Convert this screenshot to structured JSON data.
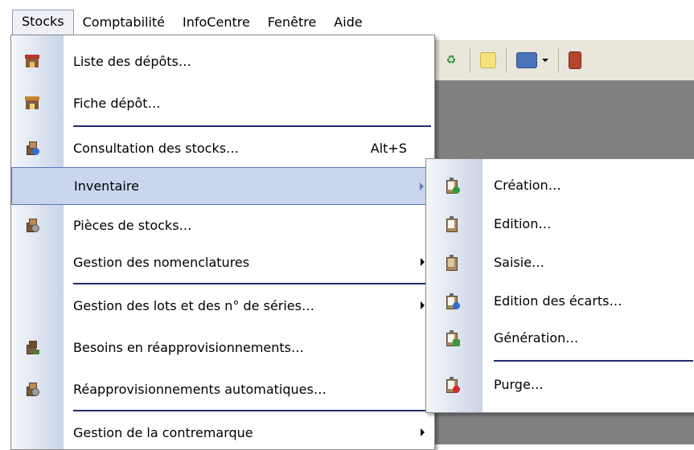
{
  "menubar": {
    "items": [
      {
        "label": "Stocks"
      },
      {
        "label": "Comptabilité"
      },
      {
        "label": "InfoCentre"
      },
      {
        "label": "Fenêtre"
      },
      {
        "label": "Aide"
      }
    ]
  },
  "stocks_menu": {
    "items": [
      {
        "label": "Liste des dépôts…",
        "icon": "depot-icon"
      },
      {
        "label": "Fiche dépôt…",
        "icon": "depot-card-icon"
      },
      {
        "label": "Consultation des stocks…",
        "shortcut": "Alt+S",
        "icon": "stock-query-icon"
      },
      {
        "label": "Inventaire",
        "submenu": true
      },
      {
        "label": "Pièces de stocks…",
        "icon": "stock-documents-icon"
      },
      {
        "label": "Gestion des nomenclatures",
        "submenu": true
      },
      {
        "label": "Gestion des lots et des n° de séries…",
        "submenu": true
      },
      {
        "label": "Besoins en réapprovisionnements…",
        "icon": "replenishment-needs-icon"
      },
      {
        "label": "Réapprovisionnements automatiques…",
        "icon": "auto-replenishment-icon"
      },
      {
        "label": "Gestion de la contremarque",
        "submenu": true
      }
    ]
  },
  "inventaire_submenu": {
    "items": [
      {
        "label": "Création…",
        "icon": "inventory-create-icon"
      },
      {
        "label": "Edition…",
        "icon": "inventory-edit-icon"
      },
      {
        "label": "Saisie…",
        "icon": "inventory-entry-icon"
      },
      {
        "label": "Edition des écarts…",
        "icon": "inventory-variance-icon"
      },
      {
        "label": "Génération…",
        "icon": "inventory-generate-icon"
      },
      {
        "label": "Purge…",
        "icon": "inventory-purge-icon"
      }
    ]
  },
  "colors": {
    "highlight": "#c9d6ee",
    "highlight_border": "#5877b8",
    "separator": "#1f2e6a",
    "gutter": "#c9d3e7"
  }
}
